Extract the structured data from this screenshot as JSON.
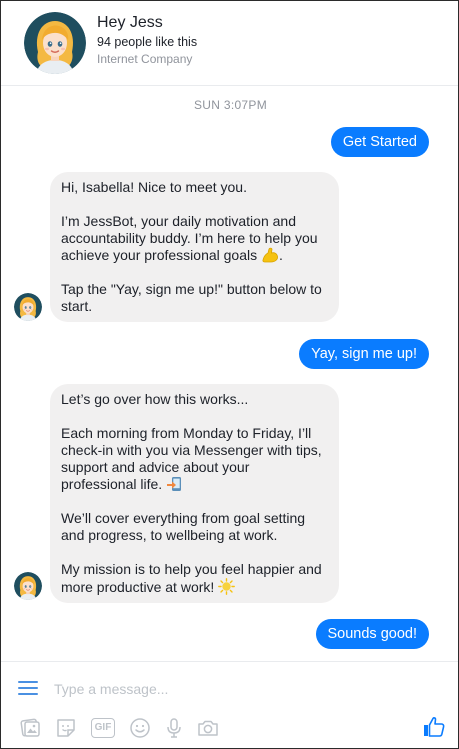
{
  "header": {
    "name": "Hey Jess",
    "likes": "94 people like this",
    "category": "Internet Company"
  },
  "timestamp": "SUN 3:07PM",
  "messages": [
    {
      "from": "user",
      "text": "Get Started"
    },
    {
      "from": "bot",
      "paragraphs": [
        "Hi, Isabella! Nice to meet you.",
        "I’m JessBot, your daily motivation and accountability buddy. I’m here to help you achieve your professional goals",
        "Tap the \"Yay, sign me up!\" button below to start."
      ],
      "emoji": "flexed-biceps-icon"
    },
    {
      "from": "user",
      "text": "Yay, sign me up!"
    },
    {
      "from": "bot",
      "paragraphs": [
        "Let’s go over how this works...",
        "Each morning from Monday to Friday, I’ll check-in with you via Messenger with tips, support and advice about your professional life.",
        "We’ll cover everything from goal setting and progress, to wellbeing at work.",
        "My mission is to help you feel happier and more productive at work!"
      ],
      "emojis": [
        "phone-arrow-icon",
        "sun-icon"
      ]
    },
    {
      "from": "user",
      "text": "Sounds good!"
    }
  ],
  "composer": {
    "placeholder": "Type a message...",
    "tools": [
      "image-icon",
      "sticker-icon",
      "gif-icon",
      "emoji-icon",
      "microphone-icon",
      "camera-icon"
    ],
    "gif_label": "GIF",
    "send_icon": "thumbs-up-icon"
  },
  "colors": {
    "accent": "#0a7cff",
    "incoming_bubble": "#f1f0f0",
    "icon": "#4a90e2"
  }
}
